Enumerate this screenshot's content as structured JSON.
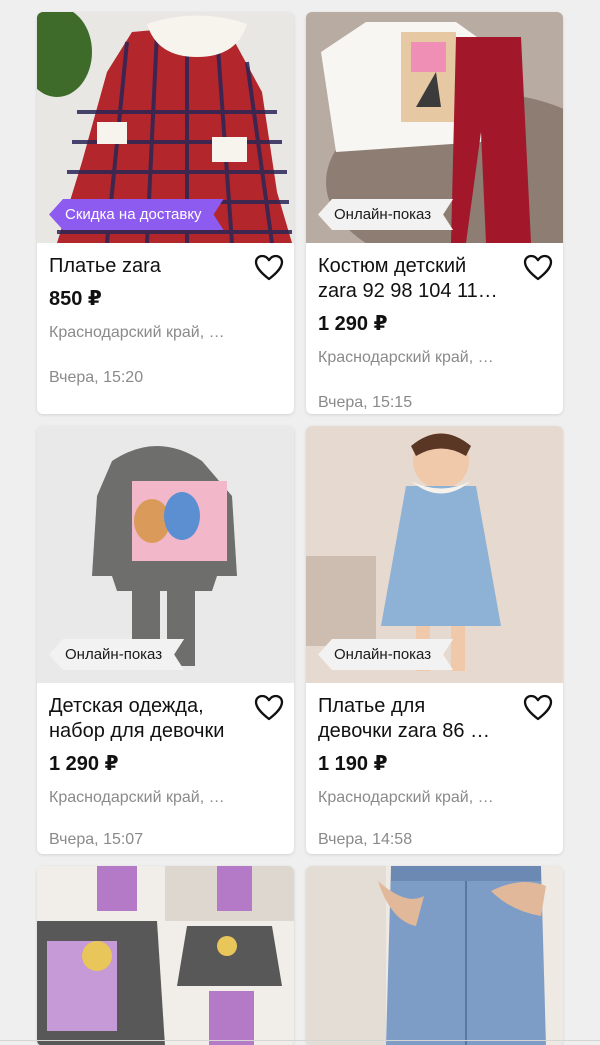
{
  "colors": {
    "badge_promo": "#8e5bf0",
    "badge_neutral": "#f2f2f2",
    "text_muted": "#8a8a8a"
  },
  "listings": [
    {
      "title_lines": [
        "Платье zara"
      ],
      "price": "850 ₽",
      "location": "Краснодарский край, …",
      "time": "Вчера, 15:20",
      "badge": "Скидка на доставку",
      "badge_style": "promo",
      "icon": "heart-outline-icon"
    },
    {
      "title_lines": [
        "Костюм детский",
        "zara 92 98 104 11…"
      ],
      "price": "1 290 ₽",
      "location": "Краснодарский край, …",
      "time": "Вчера, 15:15",
      "badge": "Онлайн-показ",
      "badge_style": "neutral",
      "icon": "heart-outline-icon"
    },
    {
      "title_lines": [
        "Детская одежда,",
        "набор для девочки"
      ],
      "price": "1 290 ₽",
      "location": "Краснодарский край, …",
      "time": "Вчера, 15:07",
      "badge": "Онлайн-показ",
      "badge_style": "neutral",
      "icon": "heart-outline-icon"
    },
    {
      "title_lines": [
        "Платье для",
        "девочки zara 86 …"
      ],
      "price": "1 190 ₽",
      "location": "Краснодарский край, …",
      "time": "Вчера, 14:58",
      "badge": "Онлайн-показ",
      "badge_style": "neutral",
      "icon": "heart-outline-icon"
    },
    {
      "title_lines": [],
      "price": "",
      "location": "",
      "time": "",
      "badge": "",
      "badge_style": "none",
      "icon": ""
    },
    {
      "title_lines": [],
      "price": "",
      "location": "",
      "time": "",
      "badge": "",
      "badge_style": "none",
      "icon": ""
    }
  ]
}
